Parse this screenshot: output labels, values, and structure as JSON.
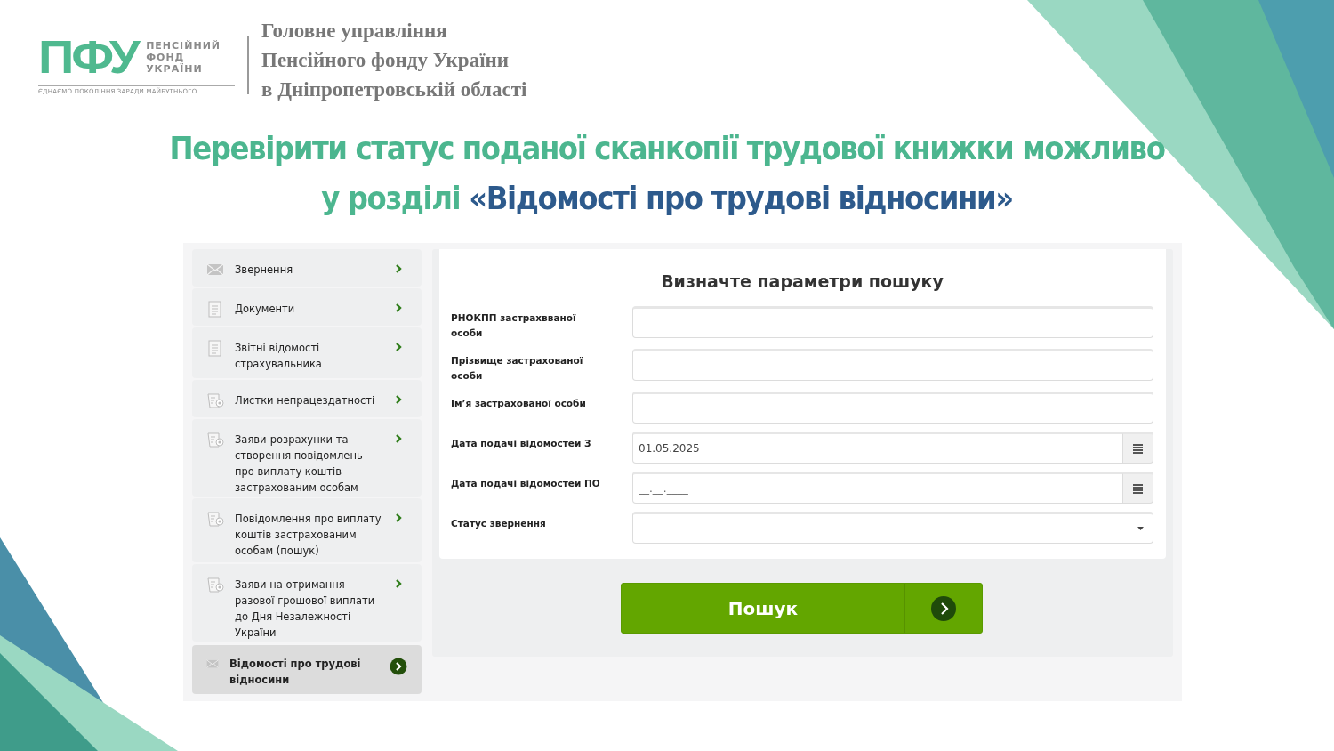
{
  "header": {
    "logo_mark": "ПФУ",
    "logo_name": [
      "ПЕНСІЙНИЙ",
      "ФОНД",
      "УКРАЇНИ"
    ],
    "logo_tagline": "ЄДНАЄМО ПОКОЛІННЯ ЗАРАДИ МАЙБУТНЬОГО",
    "organization": [
      "Головне управління",
      "Пенсійного фонду України",
      "в Дніпропетровській області"
    ]
  },
  "headline": {
    "lead": "Перевірити статус поданої сканкопії трудової книжки можливо у розділі",
    "highlight": "«Відомості про трудові відносини»"
  },
  "sidebar": {
    "items": [
      {
        "label": "Звернення",
        "kind": "envelope",
        "selected": false
      },
      {
        "label": "Документи",
        "kind": "document",
        "selected": false
      },
      {
        "label": "Звітні відомості страхувальника",
        "kind": "document",
        "selected": false
      },
      {
        "label": "Листки непрацездатності",
        "kind": "certificate",
        "selected": false
      },
      {
        "label": "Заяви-розрахунки та створення повідомлень про виплату коштів застрахованим особам",
        "kind": "certificate",
        "selected": false
      },
      {
        "label": "Повідомлення про виплату коштів застрахованим особам (пошук)",
        "kind": "certificate",
        "selected": false
      },
      {
        "label": "Заяви на отримання разової грошової виплати до Дня Незалежності України",
        "kind": "certificate",
        "selected": false
      },
      {
        "label": "Відомості про трудові відносини",
        "kind": "envelope",
        "selected": true
      }
    ]
  },
  "search_form": {
    "title": "Визначте параметри пошуку",
    "fields": [
      {
        "label": "РНОКПП застрахвваної особи",
        "kind": "text"
      },
      {
        "label": "Прізвище застрахованої особи",
        "kind": "text"
      },
      {
        "label": "Ім’я застрахованої особи",
        "kind": "text"
      },
      {
        "label": "Дата подачі відомостей З",
        "kind": "date",
        "value": "01.05.2025"
      },
      {
        "label": "Дата подачі відомостей ПО",
        "kind": "date",
        "placeholder": "__.__.____"
      },
      {
        "label": "Статус звернення",
        "kind": "select"
      }
    ],
    "button": "Пошук"
  }
}
